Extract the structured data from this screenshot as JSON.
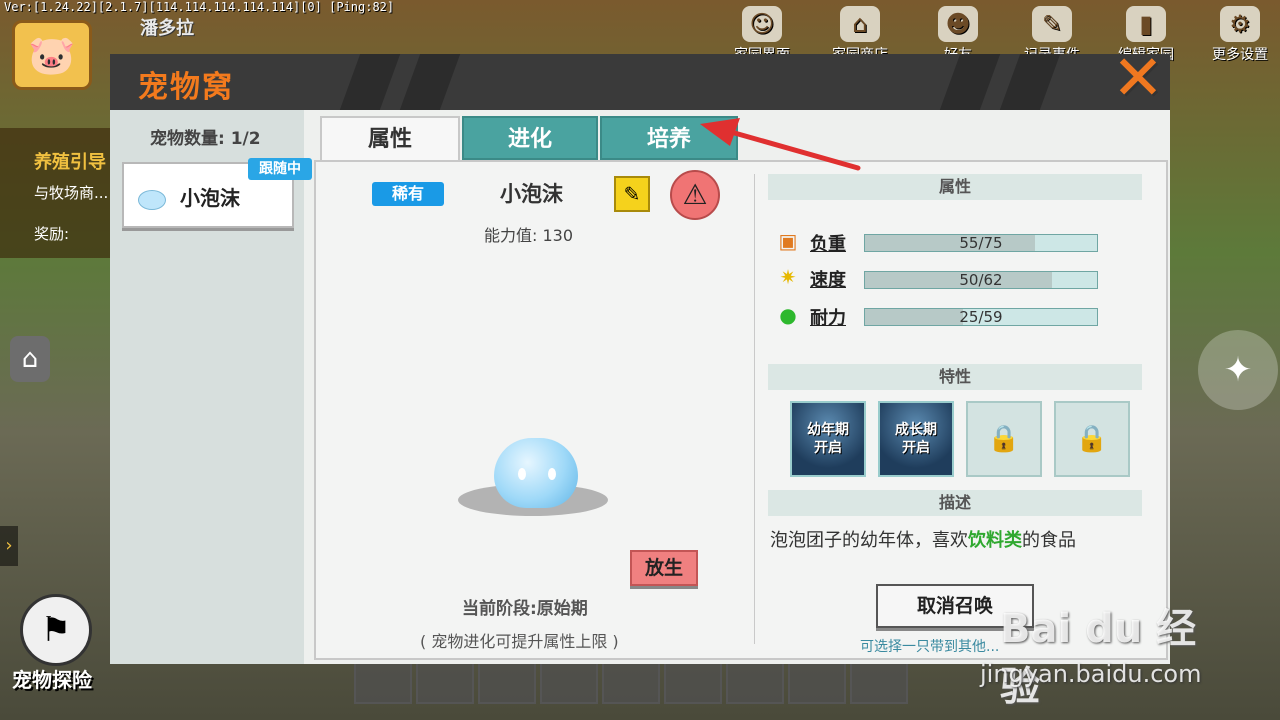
{
  "debug_line": "Ver:[1.24.22][2.1.7][114.114.114.114.114][0] [Ping:82]",
  "player_name": "潘多拉",
  "top_buttons": [
    {
      "label": "家园界面",
      "icon": "house-icon"
    },
    {
      "label": "家园商店",
      "icon": "shop-icon"
    },
    {
      "label": "好友",
      "icon": "cat-icon"
    },
    {
      "label": "记录事件",
      "icon": "note-icon"
    },
    {
      "label": "编辑家园",
      "icon": "brush-icon"
    },
    {
      "label": "更多设置",
      "icon": "gear-icon"
    }
  ],
  "breed_panel": {
    "title": "养殖引导",
    "desc": "与牧场商...",
    "reward_label": "奖励:"
  },
  "explore_label": "宠物探险",
  "dialog": {
    "title": "宠物窝",
    "close": "✕",
    "pet_count": "宠物数量: 1/2",
    "pet_card": {
      "name": "小泡沫",
      "badge": "跟随中"
    },
    "tabs": [
      "属性",
      "进化",
      "培养"
    ],
    "pet": {
      "rarity": "稀有",
      "name": "小泡沫",
      "power": "能力值: 130",
      "release": "放生",
      "stage": "当前阶段:原始期",
      "evolve_note": "( 宠物进化可提升属性上限 )"
    },
    "sections": {
      "attributes": "属性",
      "traits": "特性",
      "description": "描述"
    },
    "stats": [
      {
        "label": "负重",
        "text": "55/75",
        "value": 55,
        "max": 75,
        "icon": "weight-icon"
      },
      {
        "label": "速度",
        "text": "50/62",
        "value": 50,
        "max": 62,
        "icon": "speed-icon"
      },
      {
        "label": "耐力",
        "text": "25/59",
        "value": 25,
        "max": 59,
        "icon": "strength-icon"
      }
    ],
    "traits": [
      {
        "label": "幼年期\n开启",
        "locked": false
      },
      {
        "label": "成长期\n开启",
        "locked": false
      },
      {
        "label": "",
        "locked": true
      },
      {
        "label": "",
        "locked": true
      }
    ],
    "description": {
      "before": "泡泡团子的幼年体，喜欢",
      "highlight": "饮料类",
      "after": "的食品"
    },
    "cancel_summon": "取消召唤",
    "hint": "可选择一只带到其他..."
  },
  "watermark": {
    "logo": "Bai du 经验",
    "url": "jingyan.baidu.com"
  },
  "colors": {
    "title_orange": "#f37a1d",
    "tab_teal": "#4aa3a0",
    "rarity_blue": "#1a9ae6",
    "arrow_red": "#e03030",
    "highlight_green": "#2fa82f"
  }
}
